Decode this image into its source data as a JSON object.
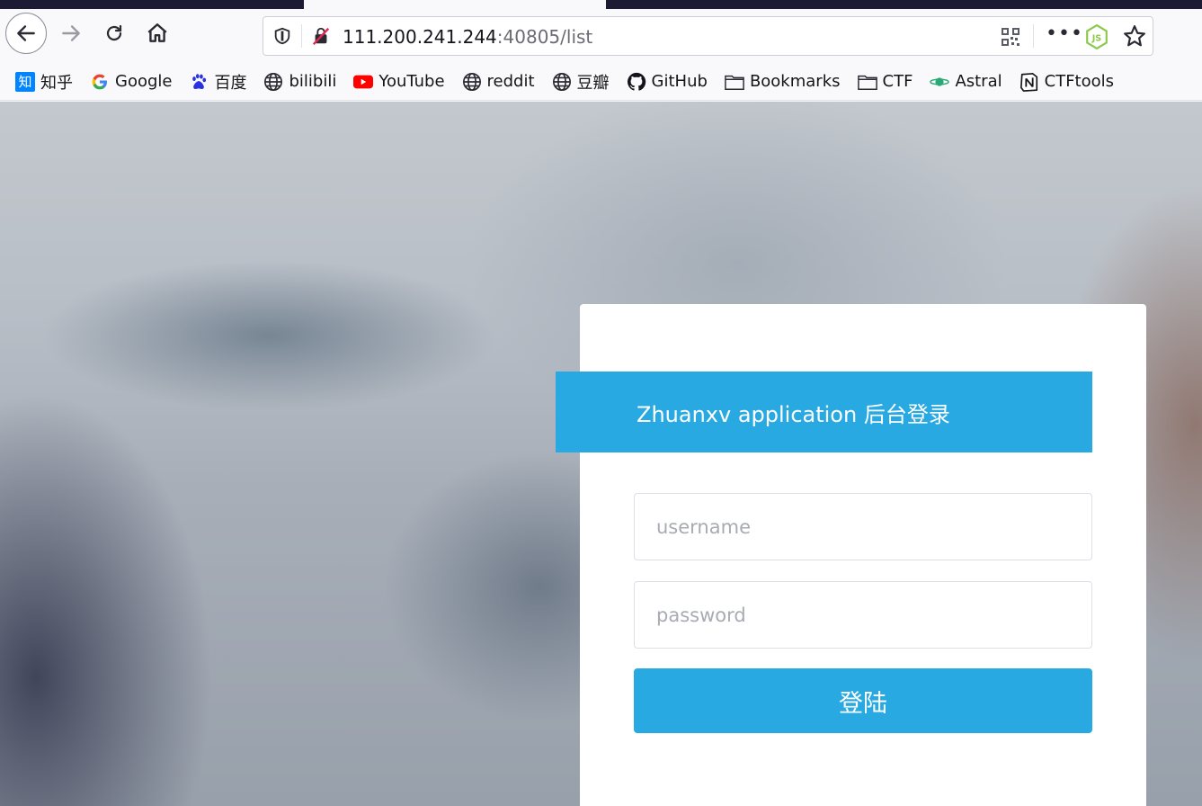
{
  "browser": {
    "url": {
      "host": "111.200.241.244",
      "rest": ":40805/list"
    },
    "more_label": "•••",
    "bookmarks": [
      {
        "label": "知乎",
        "icon": "zhihu-icon"
      },
      {
        "label": "Google",
        "icon": "google-icon"
      },
      {
        "label": "百度",
        "icon": "baidu-paw-icon"
      },
      {
        "label": "bilibili",
        "icon": "globe-icon"
      },
      {
        "label": "YouTube",
        "icon": "youtube-icon"
      },
      {
        "label": "reddit",
        "icon": "globe-icon"
      },
      {
        "label": "豆瓣",
        "icon": "globe-icon"
      },
      {
        "label": "GitHub",
        "icon": "github-icon"
      },
      {
        "label": "Bookmarks",
        "icon": "folder-icon"
      },
      {
        "label": "CTF",
        "icon": "folder-icon"
      },
      {
        "label": "Astral",
        "icon": "planet-icon"
      },
      {
        "label": "CTFtools",
        "icon": "notion-icon"
      }
    ],
    "zhihu_glyph": "知"
  },
  "login": {
    "title": "Zhuanxv application 后台登录",
    "username_placeholder": "username",
    "password_placeholder": "password",
    "submit_label": "登陆"
  },
  "colors": {
    "accent": "#29a9e2",
    "tab_strip": "#1c1b33"
  }
}
